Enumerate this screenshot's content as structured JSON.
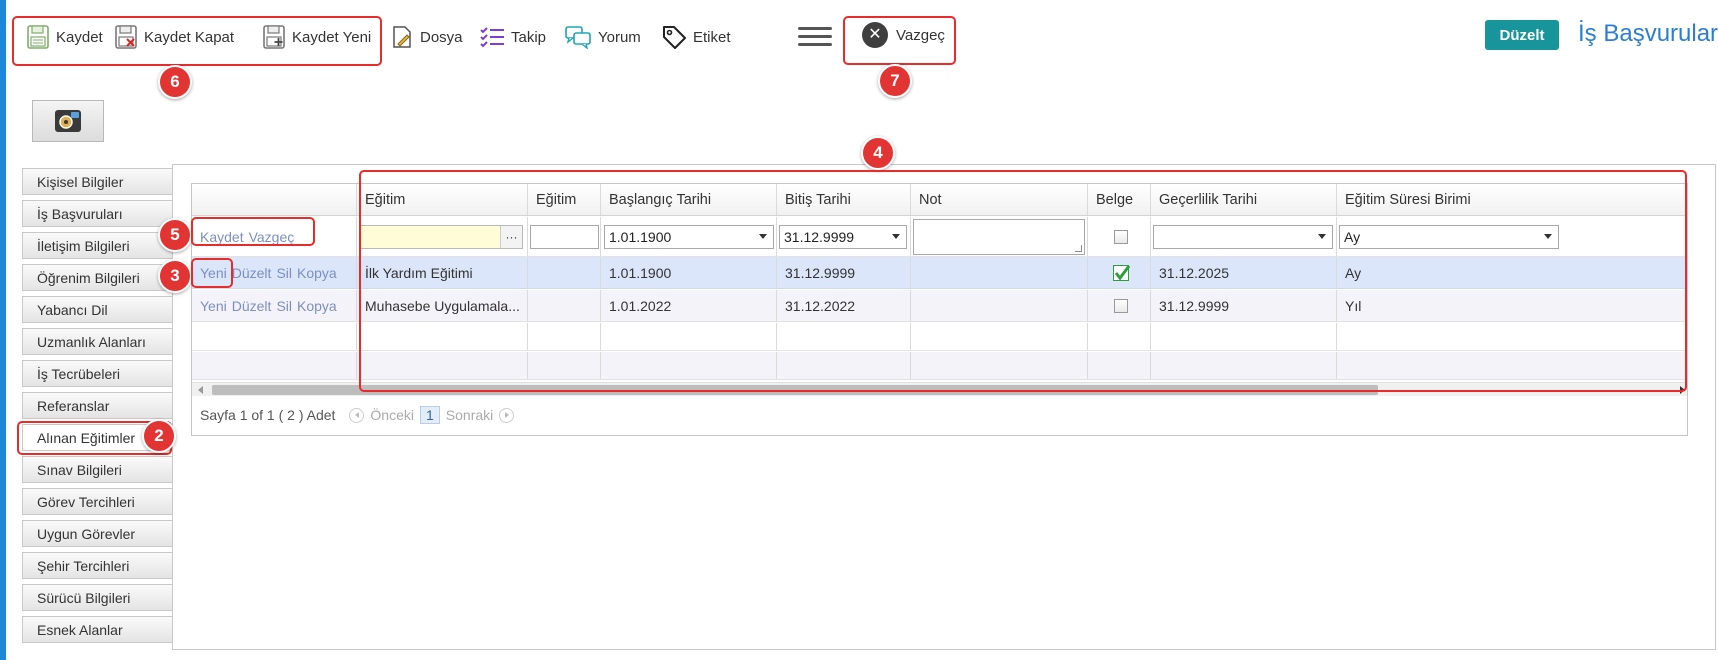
{
  "toolbar": {
    "save": "Kaydet",
    "save_close": "Kaydet Kapat",
    "save_new": "Kaydet Yeni",
    "file": "Dosya",
    "follow": "Takip",
    "comment": "Yorum",
    "tag": "Etiket",
    "cancel": "Vazgeç",
    "edit": "Düzelt",
    "title": "İş Başvuruları"
  },
  "sidebar": {
    "items": [
      {
        "label": "Kişisel Bilgiler"
      },
      {
        "label": "İş Başvuruları"
      },
      {
        "label": "İletişim Bilgileri"
      },
      {
        "label": "Öğrenim Bilgileri"
      },
      {
        "label": "Yabancı Dil"
      },
      {
        "label": "Uzmanlık Alanları"
      },
      {
        "label": "İş Tecrübeleri"
      },
      {
        "label": "Referanslar"
      },
      {
        "label": "Alınan Eğitimler"
      },
      {
        "label": "Sınav Bilgileri"
      },
      {
        "label": "Görev Tercihleri"
      },
      {
        "label": "Uygun Görevler"
      },
      {
        "label": "Şehir Tercihleri"
      },
      {
        "label": "Sürücü Bilgileri"
      },
      {
        "label": "Esnek Alanlar"
      }
    ]
  },
  "grid": {
    "columns": [
      "",
      "Eğitim",
      "Eğitim",
      "Başlangıç Tarihi",
      "Bitiş Tarihi",
      "Not",
      "Belge",
      "Geçerlilik Tarihi",
      "Eğitim Süresi Birimi"
    ],
    "edit_row": {
      "save_link": "Kaydet",
      "cancel_link": "Vazgeç",
      "egitim_value": "",
      "egitim2_value": "",
      "start_date": "1.01.1900",
      "end_date": "31.12.9999",
      "note": "",
      "validity_date": "",
      "duration_unit": "Ay"
    },
    "row_actions": {
      "new": "Yeni",
      "edit": "Düzelt",
      "delete": "Sil",
      "copy": "Kopya"
    },
    "rows": [
      {
        "egitim": "İlk Yardım Eğitimi",
        "egitim2": "",
        "start": "1.01.1900",
        "end": "31.12.9999",
        "note": "",
        "belge": true,
        "validity": "31.12.2025",
        "unit": "Ay"
      },
      {
        "egitim": "Muhasebe Uygulamala...",
        "egitim2": "",
        "start": "1.01.2022",
        "end": "31.12.2022",
        "note": "",
        "belge": false,
        "validity": "31.12.9999",
        "unit": "Yıl"
      }
    ]
  },
  "pager": {
    "text": "Sayfa 1 of 1 ( 2 ) Adet",
    "prev": "Önceki",
    "page": "1",
    "next": "Sonraki"
  },
  "annotations": [
    "2",
    "3",
    "4",
    "5",
    "6",
    "7"
  ],
  "colors": {
    "accent": "#17959a",
    "title": "#2a7fd4",
    "annotation": "#e82b2b",
    "selected_row": "#dbe6fb"
  },
  "icons": [
    "save-icon",
    "save-close-icon",
    "save-new-icon",
    "file-icon",
    "follow-icon",
    "comment-icon",
    "tag-icon",
    "hamburger-menu-icon",
    "close-icon",
    "gear-icon"
  ]
}
